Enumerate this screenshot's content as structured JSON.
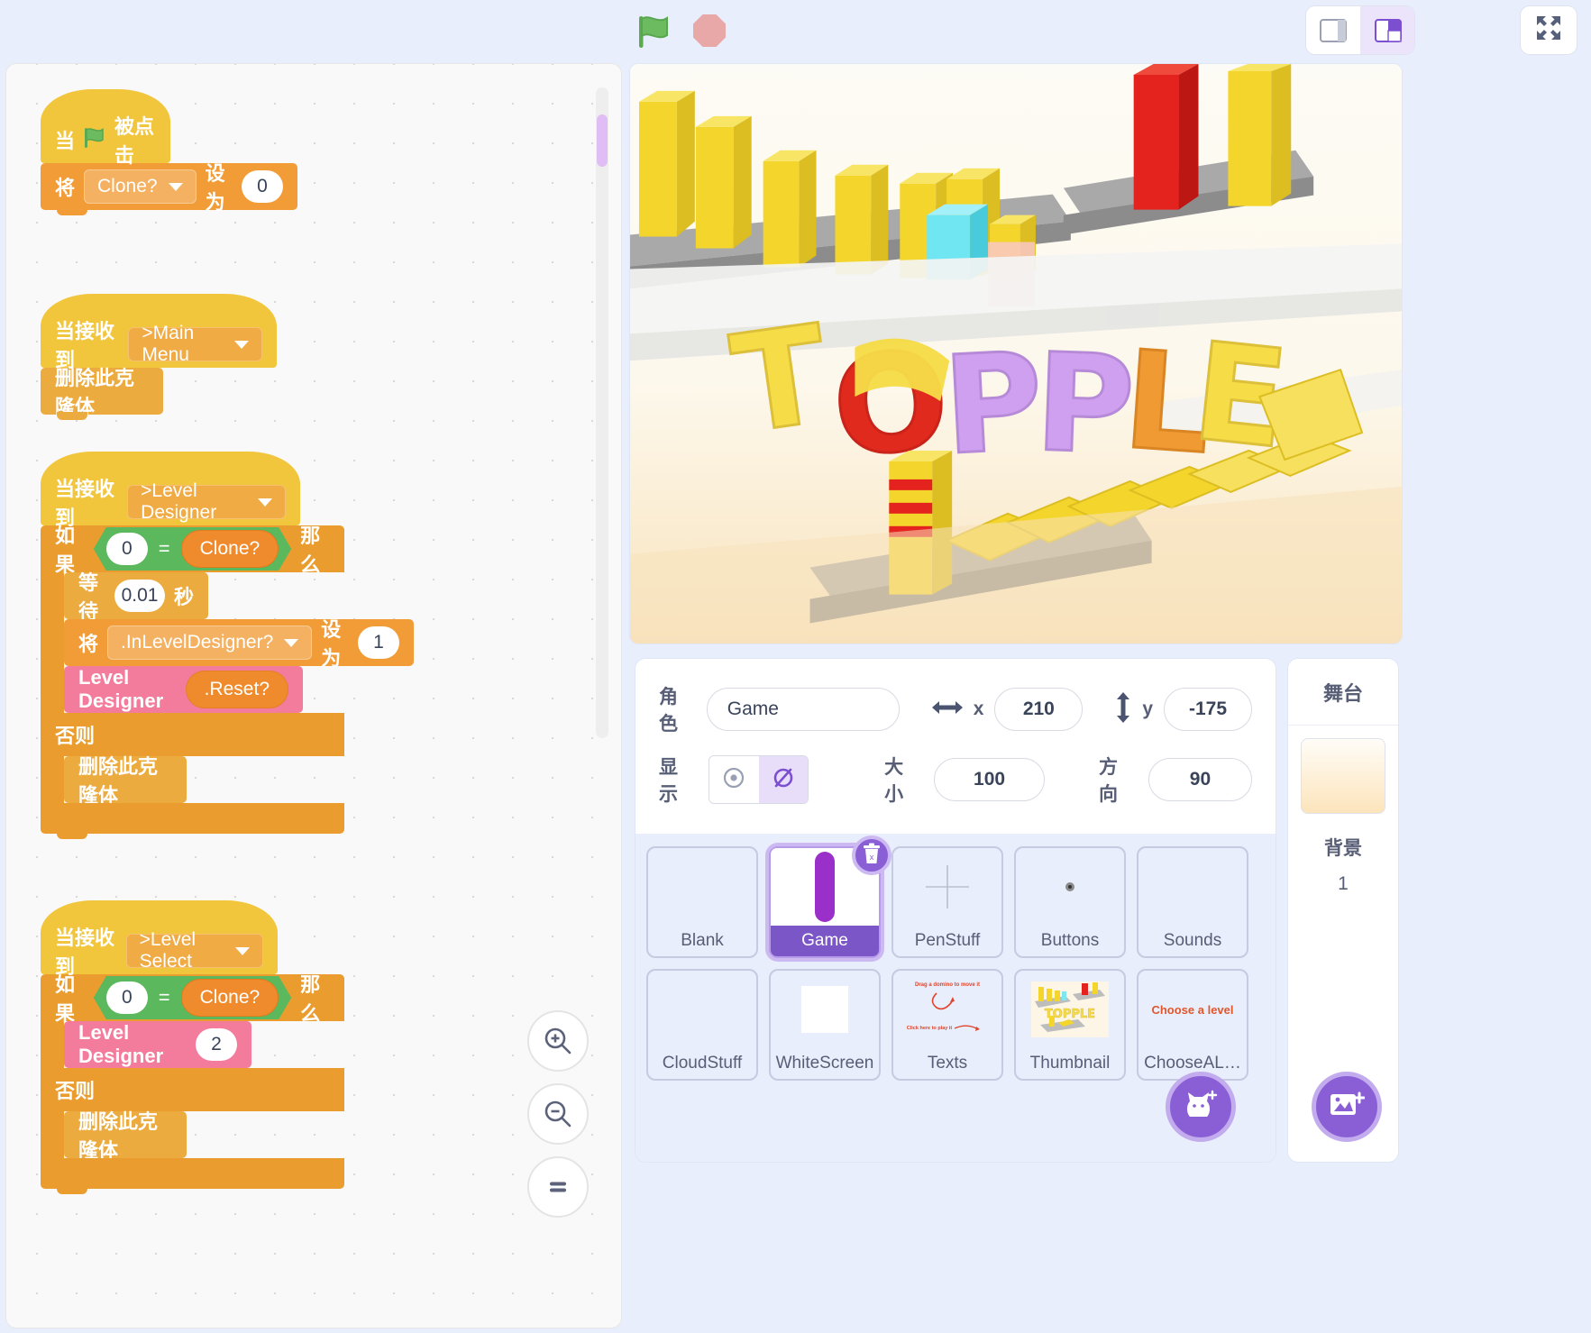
{
  "toolbar": {
    "green_flag_icon": "green-flag-icon",
    "stop_icon": "stop-sign-icon",
    "layout_small_icon": "small-stage-layout-icon",
    "layout_large_icon": "large-stage-layout-icon",
    "fullscreen_icon": "fullscreen-icon"
  },
  "workspace": {
    "zoom_in_icon": "zoom-in-icon",
    "zoom_out_icon": "zoom-out-icon",
    "zoom_reset_icon": "zoom-reset-icon",
    "scripts": [
      {
        "hat": {
          "prefix": "当",
          "icon": "green-flag-icon",
          "suffix": "被点击"
        },
        "blocks": [
          {
            "type": "set-var",
            "label": "将",
            "dropdown": "Clone?",
            "label2": "设为",
            "value": "0"
          }
        ]
      },
      {
        "hat": {
          "prefix": "当接收到",
          "dropdown": ">Main Menu"
        },
        "blocks": [
          {
            "type": "simple",
            "label": "删除此克隆体"
          }
        ]
      },
      {
        "hat": {
          "prefix": "当接收到",
          "dropdown": ">Level Designer"
        },
        "if_else": {
          "if_label": "如果",
          "then_label": "那么",
          "else_label": "否则",
          "condition": {
            "left": "0",
            "op": "=",
            "right": "Clone?"
          },
          "then_blocks": [
            {
              "type": "wait",
              "label": "等待",
              "value": "0.01",
              "unit": "秒"
            },
            {
              "type": "set-var",
              "label": "将",
              "dropdown": ".InLevelDesigner?",
              "label2": "设为",
              "value": "1"
            },
            {
              "type": "custom",
              "label": "Level Designer",
              "arg": ".Reset?"
            }
          ],
          "else_blocks": [
            {
              "type": "simple",
              "label": "删除此克隆体"
            }
          ]
        }
      },
      {
        "hat": {
          "prefix": "当接收到",
          "dropdown": ">Level Select"
        },
        "if_else": {
          "if_label": "如果",
          "then_label": "那么",
          "else_label": "否则",
          "condition": {
            "left": "0",
            "op": "=",
            "right": "Clone?"
          },
          "then_blocks": [
            {
              "type": "custom-num",
              "label": "Level Designer",
              "arg": "2"
            }
          ],
          "else_blocks": [
            {
              "type": "simple",
              "label": "删除此克隆体"
            }
          ]
        }
      }
    ]
  },
  "stage": {
    "game_title": "TOPPLE",
    "colors": {
      "sky": "#fdfaf3",
      "sand": "#fae6c0",
      "domino_yellow": "#f5d72e",
      "domino_red": "#e52421",
      "domino_cyan": "#65e4f2",
      "platform_gray": "#9b9b9b",
      "title_yellow": "#f6dc47",
      "title_red": "#e12a1e",
      "title_purple": "#cf9ff0",
      "title_orange": "#ef9a32"
    }
  },
  "sprite_info": {
    "name_label": "角色",
    "name_value": "Game",
    "x_label": "x",
    "x_value": "210",
    "y_label": "y",
    "y_value": "-175",
    "show_label": "显示",
    "show_visible_icon": "eye-icon",
    "show_hidden_icon": "eye-slash-icon",
    "size_label": "大小",
    "size_value": "100",
    "direction_label": "方向",
    "direction_value": "90",
    "x_arrow_icon": "horizontal-arrow-icon",
    "y_arrow_icon": "vertical-arrow-icon",
    "delete_icon": "trash-icon",
    "add_sprite_icon": "add-sprite-cat-icon"
  },
  "sprites": [
    {
      "name": "Blank",
      "thumb": "empty",
      "selected": false
    },
    {
      "name": "Game",
      "thumb": "purple-bar",
      "selected": true
    },
    {
      "name": "PenStuff",
      "thumb": "plus-cross",
      "selected": false
    },
    {
      "name": "Buttons",
      "thumb": "small-dot",
      "selected": false
    },
    {
      "name": "Sounds",
      "thumb": "empty",
      "selected": false
    },
    {
      "name": "CloudStuff",
      "thumb": "empty",
      "selected": false
    },
    {
      "name": "WhiteScreen",
      "thumb": "white-square",
      "selected": false
    },
    {
      "name": "Texts",
      "thumb": "red-annotations",
      "selected": false
    },
    {
      "name": "Thumbnail",
      "thumb": "topple-thumb",
      "selected": false
    },
    {
      "name": "ChooseAL…",
      "thumb": "choose-a-level-text",
      "selected": false
    }
  ],
  "sprite_thumb_texts": {
    "texts_line1": "Drag a domino to move it",
    "texts_line2": "Click here to play it",
    "choose_level": "Choose a level"
  },
  "stage_pane": {
    "title": "舞台",
    "backdrop_label": "背景",
    "backdrop_count": "1",
    "add_backdrop_icon": "add-backdrop-image-icon"
  }
}
